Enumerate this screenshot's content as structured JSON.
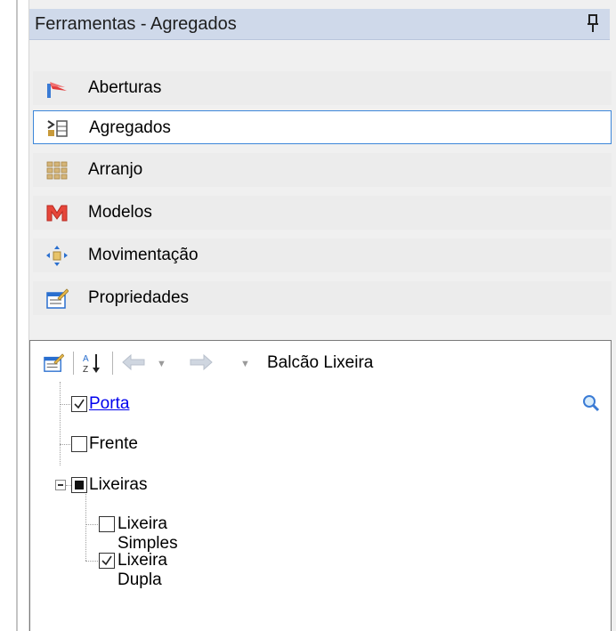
{
  "panel": {
    "title": "Ferramentas - Agregados"
  },
  "nav": {
    "items": [
      {
        "label": "Aberturas",
        "icon": "flag-icon"
      },
      {
        "label": "Agregados",
        "icon": "aggregate-icon",
        "selected": true
      },
      {
        "label": "Arranjo",
        "icon": "grid-icon"
      },
      {
        "label": "Modelos",
        "icon": "models-m-icon"
      },
      {
        "label": "Movimentação",
        "icon": "move-arrows-icon"
      },
      {
        "label": "Propriedades",
        "icon": "properties-icon"
      }
    ]
  },
  "properties": {
    "path": "Balcão Lixeira",
    "tree": [
      {
        "label": "Porta",
        "checked": "checked",
        "link": true
      },
      {
        "label": "Frente",
        "checked": "unchecked"
      },
      {
        "label": "Lixeiras",
        "checked": "partial",
        "expanded": true,
        "children": [
          {
            "label": "Lixeira Simples",
            "checked": "unchecked"
          },
          {
            "label": "Lixeira Dupla",
            "checked": "checked"
          }
        ]
      }
    ]
  },
  "colors": {
    "titlebar": "#cfd9ea",
    "selected_border": "#3c86d9",
    "link": "#0000ee"
  }
}
